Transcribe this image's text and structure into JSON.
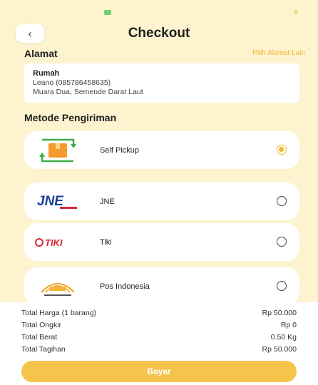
{
  "header": {
    "title": "Checkout",
    "back_icon": "chevron-left-icon"
  },
  "address": {
    "section_label": "Alamat",
    "change_link": "Pilih Alamat Lain",
    "name": "Rumah",
    "recipient": "Leano (085786458635)",
    "location": "Muara Dua, Semende Darat Laut"
  },
  "shipping": {
    "section_label": "Metode Pengiriman",
    "options": [
      {
        "label": "Self Pickup",
        "icon": "self-pickup-icon",
        "selected": true
      },
      {
        "label": "JNE",
        "icon": "jne-logo",
        "selected": false
      },
      {
        "label": "Tiki",
        "icon": "tiki-logo",
        "selected": false
      },
      {
        "label": "Pos Indonesia",
        "icon": "pos-indonesia-logo",
        "selected": false
      }
    ]
  },
  "logos": {
    "jne_text": "JNE",
    "tiki_text": "TIKI"
  },
  "summary": {
    "rows": [
      {
        "label": "Total Harga (1 barang)",
        "value": "Rp 50.000"
      },
      {
        "label": "Total Ongkir",
        "value": "Rp 0"
      },
      {
        "label": "Total Berat",
        "value": "0.50 Kg"
      },
      {
        "label": "Total Tagihan",
        "value": "Rp 50.000"
      }
    ],
    "pay_label": "Bayar"
  },
  "colors": {
    "background": "#fdf3cf",
    "accent": "#f0b52c",
    "button": "#f5c44a",
    "jne_blue": "#1c3f95",
    "tiki_red": "#d7282f"
  }
}
